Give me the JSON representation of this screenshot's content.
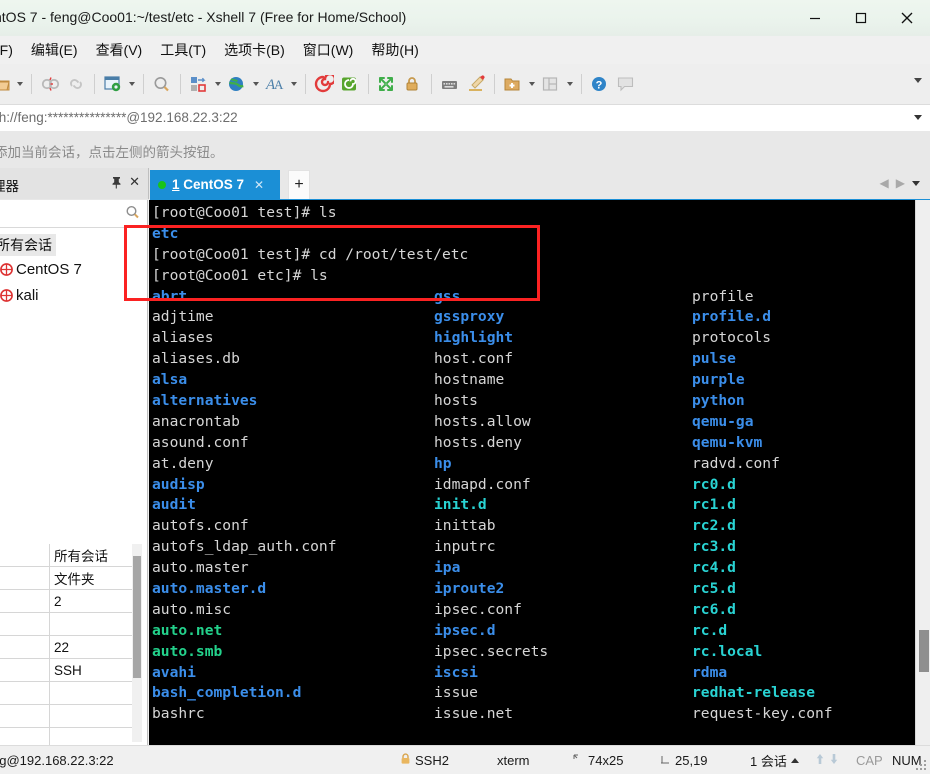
{
  "window": {
    "title": "ntOS 7 - feng@Coo01:~/test/etc - Xshell 7 (Free for Home/School)",
    "minimize": "─",
    "maximize": "□",
    "close": "✕"
  },
  "menu": {
    "items": [
      {
        "label": "(F)",
        "name": "menu-file"
      },
      {
        "label": "编辑(E)",
        "name": "menu-edit"
      },
      {
        "label": "查看(V)",
        "name": "menu-view"
      },
      {
        "label": "工具(T)",
        "name": "menu-tools"
      },
      {
        "label": "选项卡(B)",
        "name": "menu-tabs"
      },
      {
        "label": "窗口(W)",
        "name": "menu-window"
      },
      {
        "label": "帮助(H)",
        "name": "menu-help"
      }
    ]
  },
  "toolbar": {
    "icons": [
      "open-folder-icon",
      "disconnect-icon",
      "link-icon",
      "session-properties-icon",
      "find-icon",
      "transfer-icon",
      "globe-icon",
      "font-icon",
      "sftp-icon",
      "ftp-icon",
      "fullscreen-icon",
      "lock-icon",
      "keyboard-icon",
      "highlight-icon",
      "new-file-icon",
      "layout-icon",
      "help-icon",
      "comment-icon"
    ],
    "overflow": "toolbar-overflow-caret"
  },
  "address": {
    "value": "sh://feng:***************@192.168.22.3:22",
    "dropdown": "address-dropdown-caret"
  },
  "banner": {
    "text": "添加当前会话，点击左侧的箭头按钮。"
  },
  "session_panel": {
    "title": "理器",
    "pin": "\u0001",
    "close": "✕",
    "search_placeholder": "",
    "root_label": "所有会话",
    "items": [
      {
        "label": "CentOS 7",
        "name": "sidebar-item-centos7"
      },
      {
        "label": "kali",
        "name": "sidebar-item-kali"
      }
    ],
    "properties": [
      {
        "left": "",
        "right": "所有会话"
      },
      {
        "left": "",
        "right": "文件夹"
      },
      {
        "left": "",
        "right": "2"
      },
      {
        "left": "",
        "right": ""
      },
      {
        "left": "",
        "right": "22"
      },
      {
        "left": "",
        "right": "SSH"
      },
      {
        "left": "",
        "right": ""
      },
      {
        "left": "",
        "right": ""
      },
      {
        "left": "",
        "right": ""
      }
    ]
  },
  "tabs": {
    "active": {
      "index": "1",
      "label": "CentOS 7",
      "status": "connected",
      "close": "✕"
    },
    "new_tab": "+",
    "nav_prev": "◀",
    "nav_next": "▶"
  },
  "terminal": {
    "header_lines": [
      {
        "text": "[root@Coo01 test]# ls",
        "cls": "w"
      },
      {
        "text": "etc",
        "cls": "b"
      },
      {
        "text": "[root@Coo01 test]# cd /root/test/etc",
        "cls": "w"
      },
      {
        "text": "[root@Coo01 etc]# ls",
        "cls": "w"
      }
    ],
    "columns": [
      [
        {
          "t": "abrt",
          "c": "b"
        },
        {
          "t": "adjtime",
          "c": "w"
        },
        {
          "t": "aliases",
          "c": "w"
        },
        {
          "t": "aliases.db",
          "c": "w"
        },
        {
          "t": "alsa",
          "c": "b"
        },
        {
          "t": "alternatives",
          "c": "b"
        },
        {
          "t": "anacrontab",
          "c": "w"
        },
        {
          "t": "asound.conf",
          "c": "w"
        },
        {
          "t": "at.deny",
          "c": "w"
        },
        {
          "t": "audisp",
          "c": "b"
        },
        {
          "t": "audit",
          "c": "b"
        },
        {
          "t": "autofs.conf",
          "c": "w"
        },
        {
          "t": "autofs_ldap_auth.conf",
          "c": "w"
        },
        {
          "t": "auto.master",
          "c": "w"
        },
        {
          "t": "auto.master.d",
          "c": "b"
        },
        {
          "t": "auto.misc",
          "c": "w"
        },
        {
          "t": "auto.net",
          "c": "g"
        },
        {
          "t": "auto.smb",
          "c": "g"
        },
        {
          "t": "avahi",
          "c": "b"
        },
        {
          "t": "bash_completion.d",
          "c": "b"
        },
        {
          "t": "bashrc",
          "c": "w"
        }
      ],
      [
        {
          "t": "gss",
          "c": "b"
        },
        {
          "t": "gssproxy",
          "c": "b"
        },
        {
          "t": "highlight",
          "c": "b"
        },
        {
          "t": "host.conf",
          "c": "w"
        },
        {
          "t": "hostname",
          "c": "w"
        },
        {
          "t": "hosts",
          "c": "w"
        },
        {
          "t": "hosts.allow",
          "c": "w"
        },
        {
          "t": "hosts.deny",
          "c": "w"
        },
        {
          "t": "hp",
          "c": "b"
        },
        {
          "t": "idmapd.conf",
          "c": "w"
        },
        {
          "t": "init.d",
          "c": "c"
        },
        {
          "t": "inittab",
          "c": "w"
        },
        {
          "t": "inputrc",
          "c": "w"
        },
        {
          "t": "ipa",
          "c": "b"
        },
        {
          "t": "iproute2",
          "c": "b"
        },
        {
          "t": "ipsec.conf",
          "c": "w"
        },
        {
          "t": "ipsec.d",
          "c": "b"
        },
        {
          "t": "ipsec.secrets",
          "c": "w"
        },
        {
          "t": "iscsi",
          "c": "b"
        },
        {
          "t": "issue",
          "c": "w"
        },
        {
          "t": "issue.net",
          "c": "w"
        }
      ],
      [
        {
          "t": "profile",
          "c": "w"
        },
        {
          "t": "profile.d",
          "c": "b"
        },
        {
          "t": "protocols",
          "c": "w"
        },
        {
          "t": "pulse",
          "c": "b"
        },
        {
          "t": "purple",
          "c": "b"
        },
        {
          "t": "python",
          "c": "b"
        },
        {
          "t": "qemu-ga",
          "c": "b"
        },
        {
          "t": "qemu-kvm",
          "c": "b"
        },
        {
          "t": "radvd.conf",
          "c": "w"
        },
        {
          "t": "rc0.d",
          "c": "c"
        },
        {
          "t": "rc1.d",
          "c": "c"
        },
        {
          "t": "rc2.d",
          "c": "c"
        },
        {
          "t": "rc3.d",
          "c": "c"
        },
        {
          "t": "rc4.d",
          "c": "c"
        },
        {
          "t": "rc5.d",
          "c": "c"
        },
        {
          "t": "rc6.d",
          "c": "c"
        },
        {
          "t": "rc.d",
          "c": "c"
        },
        {
          "t": "rc.local",
          "c": "c"
        },
        {
          "t": "rdma",
          "c": "b"
        },
        {
          "t": "redhat-release",
          "c": "c"
        },
        {
          "t": "request-key.conf",
          "c": "w"
        }
      ]
    ],
    "colors": {
      "background": "#000000",
      "text": "#d6d6d6",
      "directory": "#3b8eea",
      "executable": "#23d18b",
      "symlink": "#29d3d3",
      "annotation": "#fb2222"
    }
  },
  "statusbar": {
    "connection": "ng@192.168.22.3:22",
    "protocol": "SSH2",
    "term_type": "xterm",
    "size": "74x25",
    "cursor": "25,19",
    "sessions": "1 会话",
    "cap": "CAP",
    "num": "NUM"
  }
}
